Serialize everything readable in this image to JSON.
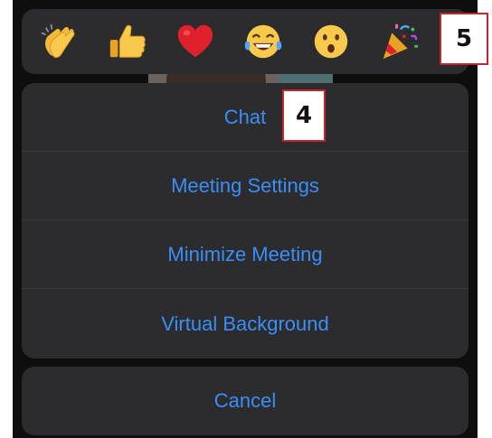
{
  "reactions": [
    {
      "icon": "clapping-hands-icon"
    },
    {
      "icon": "thumbs-up-icon"
    },
    {
      "icon": "red-heart-icon"
    },
    {
      "icon": "tears-of-joy-icon"
    },
    {
      "icon": "open-mouth-icon"
    },
    {
      "icon": "party-popper-icon"
    }
  ],
  "menu": {
    "items": [
      {
        "label": "Chat"
      },
      {
        "label": "Meeting Settings"
      },
      {
        "label": "Minimize Meeting"
      },
      {
        "label": "Virtual Background"
      }
    ],
    "cancel_label": "Cancel"
  },
  "callouts": {
    "step4": "4",
    "step5": "5"
  },
  "colors": {
    "sheet_bg": "#2c2c2e",
    "action_text": "#3a8ef6",
    "callout_border": "#c0272d"
  }
}
